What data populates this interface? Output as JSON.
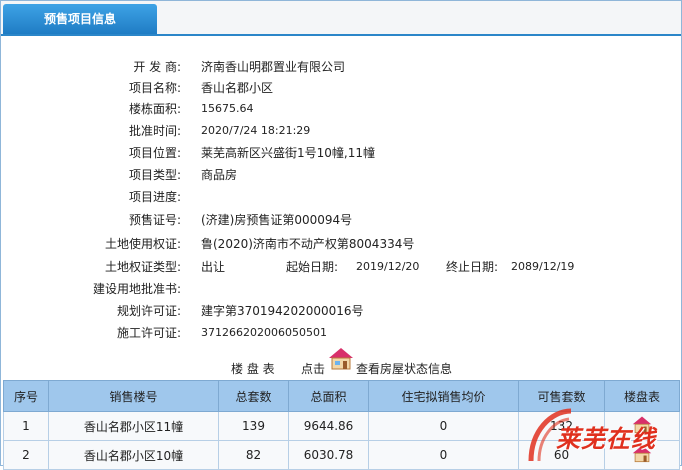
{
  "tab": {
    "title": "预售项目信息"
  },
  "info": {
    "developer_label": "开 发 商:",
    "developer": "济南香山明郡置业有限公司",
    "project_name_label": "项目名称:",
    "project_name": "香山名郡小区",
    "building_area_label": "楼栋面积:",
    "building_area": "15675.64",
    "approval_time_label": "批准时间:",
    "approval_time": "2020/7/24 18:21:29",
    "location_label": "项目位置:",
    "location": "莱芜高新区兴盛街1号10幢,11幢",
    "type_label": "项目类型:",
    "type": "商品房",
    "progress_label": "项目进度:",
    "progress": "",
    "presale_cert_label": "预售证号:",
    "presale_cert": "(济建)房预售证第000094号",
    "land_use_label": "土地使用权证:",
    "land_use": "鲁(2020)济南市不动产权第8004334号",
    "land_right_type_label": "土地权证类型:",
    "land_right_type": "出让",
    "start_date_label": "起始日期:",
    "start_date": "2019/12/20",
    "end_date_label": "终止日期:",
    "end_date": "2089/12/19",
    "land_approval_label": "建设用地批准书:",
    "land_approval": "",
    "planning_permit_label": "规划许可证:",
    "planning_permit": "建字第370194202000016号",
    "construction_permit_label": "施工许可证:",
    "construction_permit": "371266202006050501"
  },
  "legend": {
    "table_label": "楼 盘 表",
    "click_label": "点击",
    "view_label": "查看房屋状态信息"
  },
  "table": {
    "headers": [
      "序号",
      "销售楼号",
      "总套数",
      "总面积",
      "住宅拟销售均价",
      "可售套数",
      "楼盘表"
    ],
    "rows": [
      [
        "1",
        "香山名郡小区11幢",
        "139",
        "9644.86",
        "0",
        "132",
        ""
      ],
      [
        "2",
        "香山名郡小区10幢",
        "82",
        "6030.78",
        "0",
        "60",
        ""
      ]
    ]
  },
  "watermark": {
    "text": "莱芜在线"
  },
  "colors": {
    "tab_blue": "#1f7cc4",
    "header_blue": "#9fc7ec",
    "watermark_red": "#e0301e"
  }
}
